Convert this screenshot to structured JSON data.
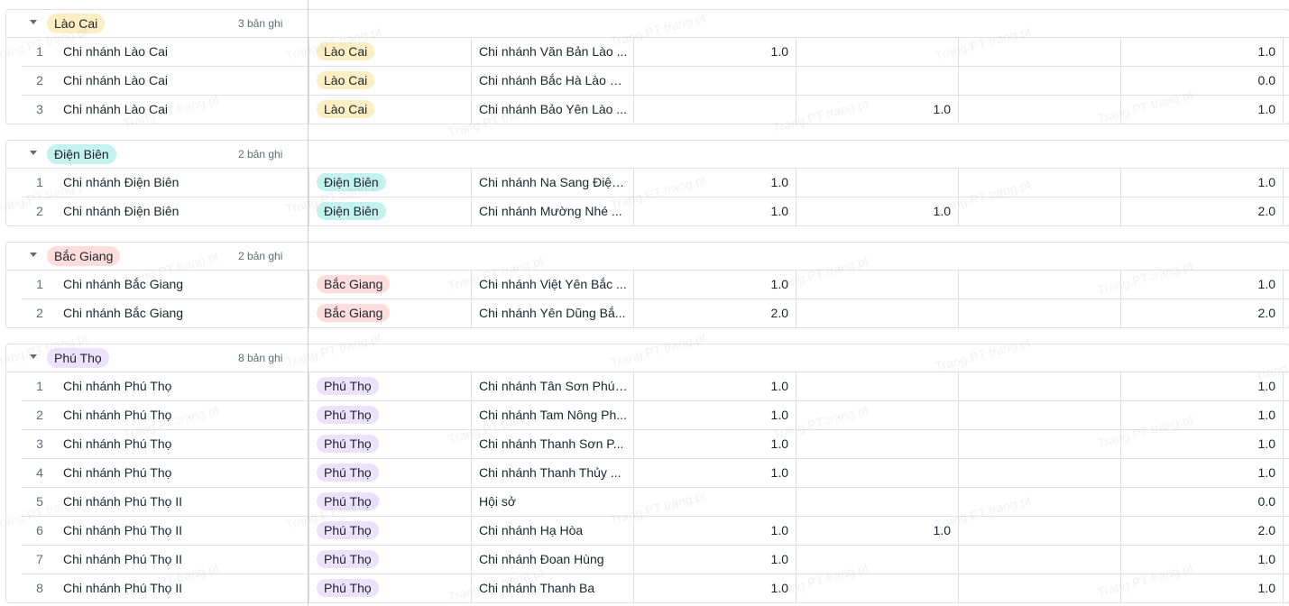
{
  "watermark": "Trang.PT trang.pt",
  "groups": [
    {
      "label": "Lào Cai",
      "count": "3 bản ghi",
      "tag_bg": "#fbeec2",
      "tag_fg": "#1f2329",
      "rows": [
        {
          "idx": "1",
          "name": "Chi nhánh Lào Cai",
          "tag": "Lào Cai",
          "branch": "Chi nhánh Văn Bản Lào ...",
          "n1": "1.0",
          "n2": "",
          "n4": "1.0"
        },
        {
          "idx": "2",
          "name": "Chi nhánh Lào Cai",
          "tag": "Lào Cai",
          "branch": "Chi nhánh Bắc Hà Lào Cai",
          "n1": "",
          "n2": "",
          "n4": "0.0"
        },
        {
          "idx": "3",
          "name": "Chi nhánh Lào Cai",
          "tag": "Lào Cai",
          "branch": "Chi nhánh Bảo Yên Lào ...",
          "n1": "",
          "n2": "1.0",
          "n4": "1.0"
        }
      ]
    },
    {
      "label": "Điện Biên",
      "count": "2 bản ghi",
      "tag_bg": "#c3f2ef",
      "tag_fg": "#1f2329",
      "rows": [
        {
          "idx": "1",
          "name": "Chi nhánh Điện Biên",
          "tag": "Điện Biên",
          "branch": "Chi nhánh Na Sang Điện...",
          "n1": "1.0",
          "n2": "",
          "n4": "1.0"
        },
        {
          "idx": "2",
          "name": "Chi nhánh Điện Biên",
          "tag": "Điện Biên",
          "branch": "Chi nhánh Mường Nhé ...",
          "n1": "1.0",
          "n2": "1.0",
          "n4": "2.0"
        }
      ]
    },
    {
      "label": "Bắc Giang",
      "count": "2 bản ghi",
      "tag_bg": "#fddcdc",
      "tag_fg": "#1f2329",
      "rows": [
        {
          "idx": "1",
          "name": "Chi nhánh Bắc Giang",
          "tag": "Bắc Giang",
          "branch": "Chi nhánh Việt Yên Bắc ...",
          "n1": "1.0",
          "n2": "",
          "n4": "1.0"
        },
        {
          "idx": "2",
          "name": "Chi nhánh Bắc Giang",
          "tag": "Bắc Giang",
          "branch": "Chi nhánh Yên Dũng Bắ...",
          "n1": "2.0",
          "n2": "",
          "n4": "2.0"
        }
      ]
    },
    {
      "label": "Phú Thọ",
      "count": "8 bản ghi",
      "tag_bg": "#ece2fe",
      "tag_fg": "#1f2329",
      "rows": [
        {
          "idx": "1",
          "name": "Chi nhánh Phú Thọ",
          "tag": "Phú Thọ",
          "branch": "Chi nhánh Tân Sơn Phú ...",
          "n1": "1.0",
          "n2": "",
          "n4": "1.0"
        },
        {
          "idx": "2",
          "name": "Chi nhánh Phú Thọ",
          "tag": "Phú Thọ",
          "branch": "Chi nhánh Tam Nông Ph...",
          "n1": "1.0",
          "n2": "",
          "n4": "1.0"
        },
        {
          "idx": "3",
          "name": "Chi nhánh Phú Thọ",
          "tag": "Phú Thọ",
          "branch": "Chi nhánh Thanh Sơn P...",
          "n1": "1.0",
          "n2": "",
          "n4": "1.0"
        },
        {
          "idx": "4",
          "name": "Chi nhánh Phú Thọ",
          "tag": "Phú Thọ",
          "branch": "Chi nhánh Thanh Thủy ...",
          "n1": "1.0",
          "n2": "",
          "n4": "1.0"
        },
        {
          "idx": "5",
          "name": "Chi nhánh Phú Thọ II",
          "tag": "Phú Thọ",
          "branch": "Hội sở",
          "n1": "",
          "n2": "",
          "n4": "0.0"
        },
        {
          "idx": "6",
          "name": "Chi nhánh Phú Thọ II",
          "tag": "Phú Thọ",
          "branch": "Chi nhánh Hạ Hòa",
          "n1": "1.0",
          "n2": "1.0",
          "n4": "2.0"
        },
        {
          "idx": "7",
          "name": "Chi nhánh Phú Thọ II",
          "tag": "Phú Thọ",
          "branch": "Chi nhánh Đoan Hùng",
          "n1": "1.0",
          "n2": "",
          "n4": "1.0"
        },
        {
          "idx": "8",
          "name": "Chi nhánh Phú Thọ II",
          "tag": "Phú Thọ",
          "branch": "Chi nhánh Thanh Ba",
          "n1": "1.0",
          "n2": "",
          "n4": "1.0"
        }
      ]
    }
  ]
}
